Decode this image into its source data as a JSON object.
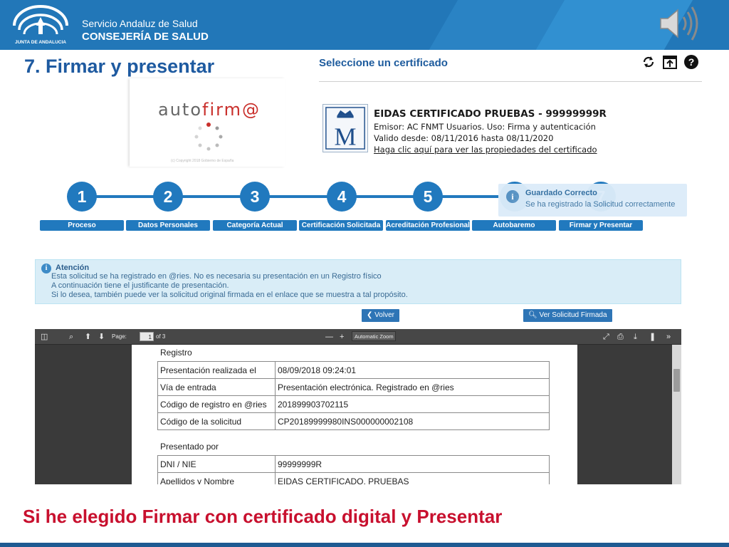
{
  "header": {
    "org_small": "JUNTA DE ANDALUCIA",
    "service": "Servicio Andaluz de Salud",
    "ministry": "CONSEJERÍA DE SALUD"
  },
  "slide_title": "7. Firmar y presentar",
  "autofirma": {
    "logo_text_a": "auto",
    "logo_text_b": "firm@",
    "copyright": "(c) Copyright 2018 Gobierno de España"
  },
  "certificate": {
    "heading": "Seleccione un certificado",
    "name": "EIDAS CERTIFICADO PRUEBAS - 99999999R",
    "issuer": "Emisor: AC FNMT Usuarios. Uso: Firma y autenticación",
    "validity": "Valido desde: 08/11/2016 hasta 08/11/2020",
    "link": "Haga clic aquí para ver las propiedades del certificado"
  },
  "steps": [
    {
      "number": "1",
      "label": "Proceso"
    },
    {
      "number": "2",
      "label": "Datos Personales"
    },
    {
      "number": "3",
      "label": "Categoría Actual"
    },
    {
      "number": "4",
      "label": "Certificación Solicitada"
    },
    {
      "number": "5",
      "label": "Acreditación Profesional"
    },
    {
      "number": "6",
      "label": "Autobaremo"
    },
    {
      "number": "7",
      "label": "Firmar y Presentar"
    }
  ],
  "toast": {
    "title": "Guardado Correcto",
    "message": "Se ha registrado la Solicitud correctamente"
  },
  "alert": {
    "title": "Atención",
    "line1": "Esta solicitud se ha registrado en @ries. No es necesaria su presentación en un Registro físico",
    "line2": "A continuación tiene el justificante de presentación.",
    "line3": "Si lo desea, también puede ver la solicitud original firmada en el enlace que se muestra a tal propósito."
  },
  "buttons": {
    "back": "Volver",
    "view_signed": "Ver Solicitud Firmada"
  },
  "pdf_viewer": {
    "page_label": "Page:",
    "page_value": "1",
    "page_total": "of 3",
    "zoom": "Automatic Zoom"
  },
  "document": {
    "registro_heading": "Registro",
    "registro_rows": [
      {
        "key": "Presentación realizada el",
        "value": "08/09/2018 09:24:01"
      },
      {
        "key": "Vía de entrada",
        "value": "Presentación electrónica. Registrado en @ries"
      },
      {
        "key": "Código de registro en @ries",
        "value": "201899903702115"
      },
      {
        "key": "Código de la solicitud",
        "value": "CP20189999980INS000000002108"
      }
    ],
    "presentado_heading": "Presentado por",
    "presentado_rows": [
      {
        "key": "DNI / NIE",
        "value": "99999999R"
      },
      {
        "key": "Apellidos y Nombre",
        "value": "EIDAS CERTIFICADO, PRUEBAS"
      }
    ]
  },
  "subtitle": "Si he elegido Firmar con certificado digital y Presentar",
  "colors": {
    "header_blue": "#2277b8",
    "step_blue": "#2179be",
    "title_blue": "#1e5aa0",
    "subtitle_red": "#c8102e"
  }
}
